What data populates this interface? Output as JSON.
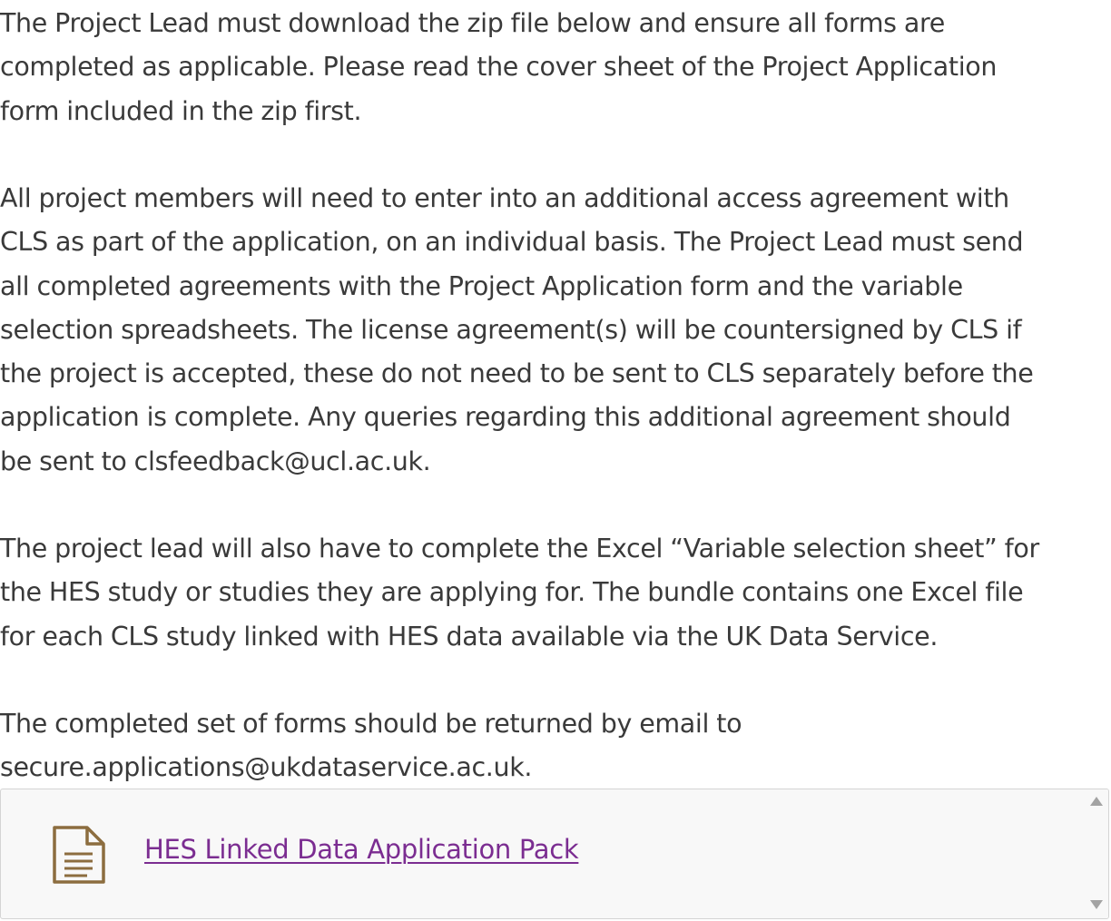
{
  "paragraphs": [
    "The Project Lead must download the zip file below and ensure all forms are\ncompleted as applicable. Please read the cover sheet of the Project Application\nform included in the zip first.",
    "All project members will need to enter into an additional access agreement with\nCLS as part of the application, on an individual basis. The Project Lead must send\nall completed agreements with the Project Application form and the variable\nselection spreadsheets. The license agreement(s) will be countersigned by CLS if\nthe project is accepted, these do not need to be sent to CLS separately before the\napplication is complete. Any queries regarding this additional agreement should\nbe sent to clsfeedback@ucl.ac.uk.",
    "The project lead will also have to complete the Excel “Variable selection sheet” for\nthe HES study or studies they are applying for. The bundle contains one Excel file\nfor each CLS study linked with HES data available via the UK Data Service.",
    "The completed set of forms should be returned by email to\nsecure.applications@ukdataservice.ac.uk."
  ],
  "attachment": {
    "icon": "document-icon",
    "link_label": "HES Linked Data Application Pack"
  },
  "colors": {
    "text": "#3a3a3a",
    "link": "#7b2d91",
    "icon": "#8c6d3f",
    "box_background": "#f8f8f8",
    "box_border": "#d4d4d4"
  }
}
